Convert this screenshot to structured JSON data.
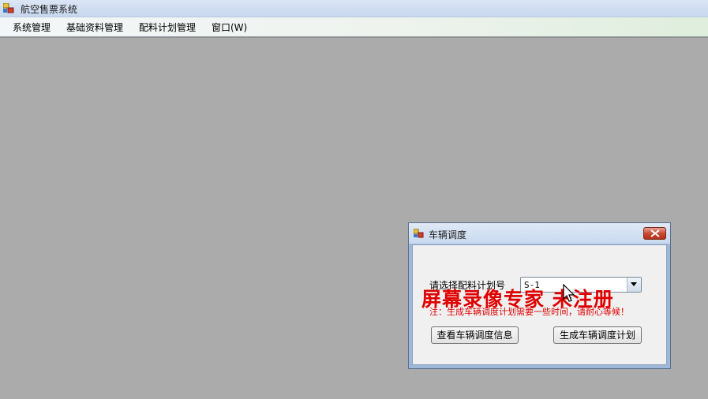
{
  "window": {
    "title": "航空售票系统",
    "icon": "app-window-icon"
  },
  "menu": {
    "items": [
      "系统管理",
      "基础资料管理",
      "配料计划管理",
      "窗口(W)"
    ]
  },
  "dialog": {
    "title": "车辆调度",
    "icon": "dialog-window-icon",
    "prompt_label": "请选择配料计划号",
    "plan_select": {
      "value": "S-1"
    },
    "note": "注：生成车辆调度计划需要一些时间，请耐心等候！",
    "view_button": "查看车辆调度信息",
    "generate_button": "生成车辆调度计划"
  },
  "watermark": "屏幕录像专家 未注册",
  "colors": {
    "desktop": "#ababab",
    "warning_text": "#e00000",
    "close_button": "#c7432c"
  }
}
